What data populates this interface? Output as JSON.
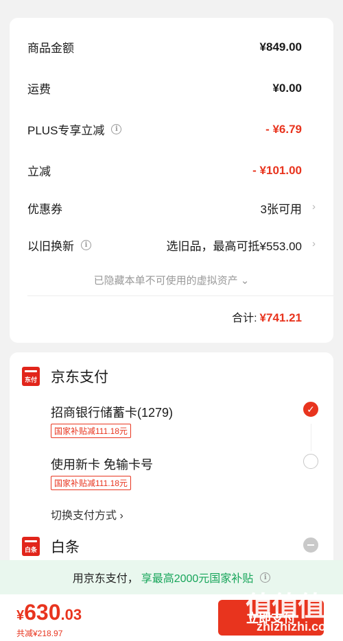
{
  "summary": {
    "goods_label": "商品金额",
    "goods_value": "¥849.00",
    "shipping_label": "运费",
    "shipping_value": "¥0.00",
    "plus_label": "PLUS专享立减",
    "plus_value": "- ¥6.79",
    "discount_label": "立减",
    "discount_value": "- ¥101.00",
    "coupon_label": "优惠券",
    "coupon_value": "3张可用",
    "tradein_label": "以旧换新",
    "tradein_value": "选旧品，最高可抵¥553.00",
    "hidden_note": "已隐藏本单不可使用的虚拟资产",
    "total_label": "合计:",
    "total_value": "¥741.21"
  },
  "payment": {
    "jd_title": "京东支付",
    "jd_logo_text": "东付",
    "cmb_card": "招商银行储蓄卡(1279)",
    "cmb_tag": "国家补贴减111.18元",
    "new_card": "使用新卡 免输卡号",
    "new_card_tag": "国家补贴减111.18元",
    "switch_label": "切换支付方式",
    "baitiao_title": "白条",
    "baitiao_logo_text": "白条"
  },
  "banner": {
    "prefix": "用京东支付，",
    "highlight": "享最高2000元国家补贴"
  },
  "footer": {
    "currency": "¥",
    "price_int": "630",
    "price_dec": ".03",
    "saved": "共减¥218.97",
    "submit_label": "立即支付"
  },
  "watermark": {
    "chars": "值值值",
    "text": "zhizhizhi.com"
  },
  "icons": {
    "info": "info-icon",
    "chevron": "chevron-right-icon",
    "check": "check-icon"
  },
  "colors": {
    "accent": "#e8341e",
    "green": "#17a55a",
    "brand": "#e1251b"
  }
}
